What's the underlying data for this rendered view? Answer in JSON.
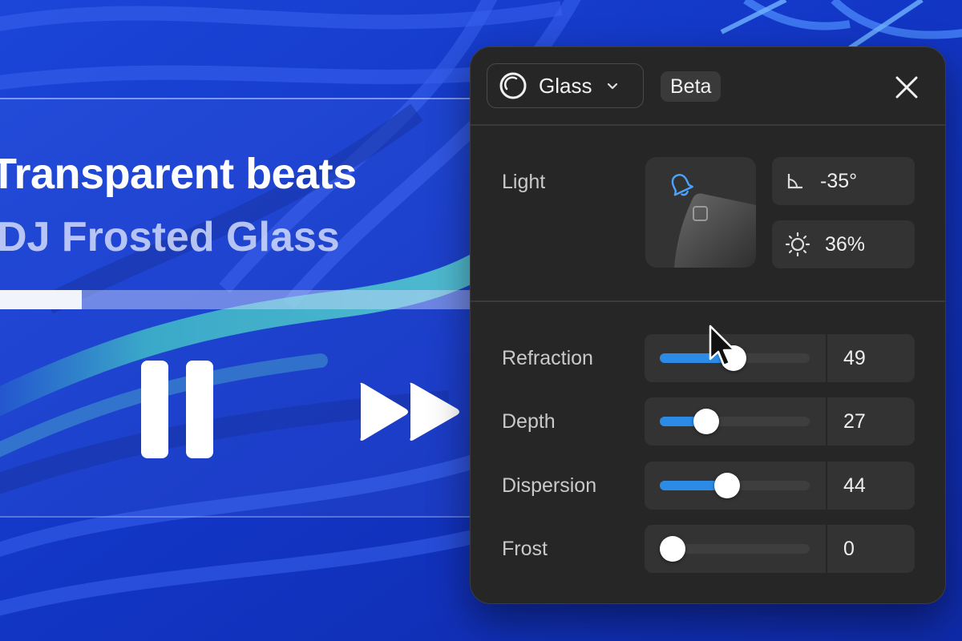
{
  "player": {
    "track_title": "Transparent beats",
    "artist": "DJ Frosted Glass",
    "progress_fraction": 0.17,
    "pause_icon": "pause-icon",
    "fast_forward_icon": "fast-forward-icon"
  },
  "panel": {
    "mode_label": "Glass",
    "mode_icon": "glass-circle-icon",
    "badge": "Beta",
    "close_icon": "close-icon",
    "light": {
      "label": "Light",
      "angle_value": "-35°",
      "intensity_value": "36%",
      "angle_icon": "angle-icon",
      "intensity_icon": "sun-icon",
      "light_icon": "bell-icon"
    },
    "sliders": [
      {
        "label": "Refraction",
        "value": "49",
        "fraction": 0.49
      },
      {
        "label": "Depth",
        "value": "27",
        "fraction": 0.27
      },
      {
        "label": "Dispersion",
        "value": "44",
        "fraction": 0.44
      },
      {
        "label": "Frost",
        "value": "0",
        "fraction": 0.0
      }
    ]
  },
  "colors": {
    "background": "#1437c8",
    "panel": "#262626",
    "accent": "#2b8be6"
  }
}
